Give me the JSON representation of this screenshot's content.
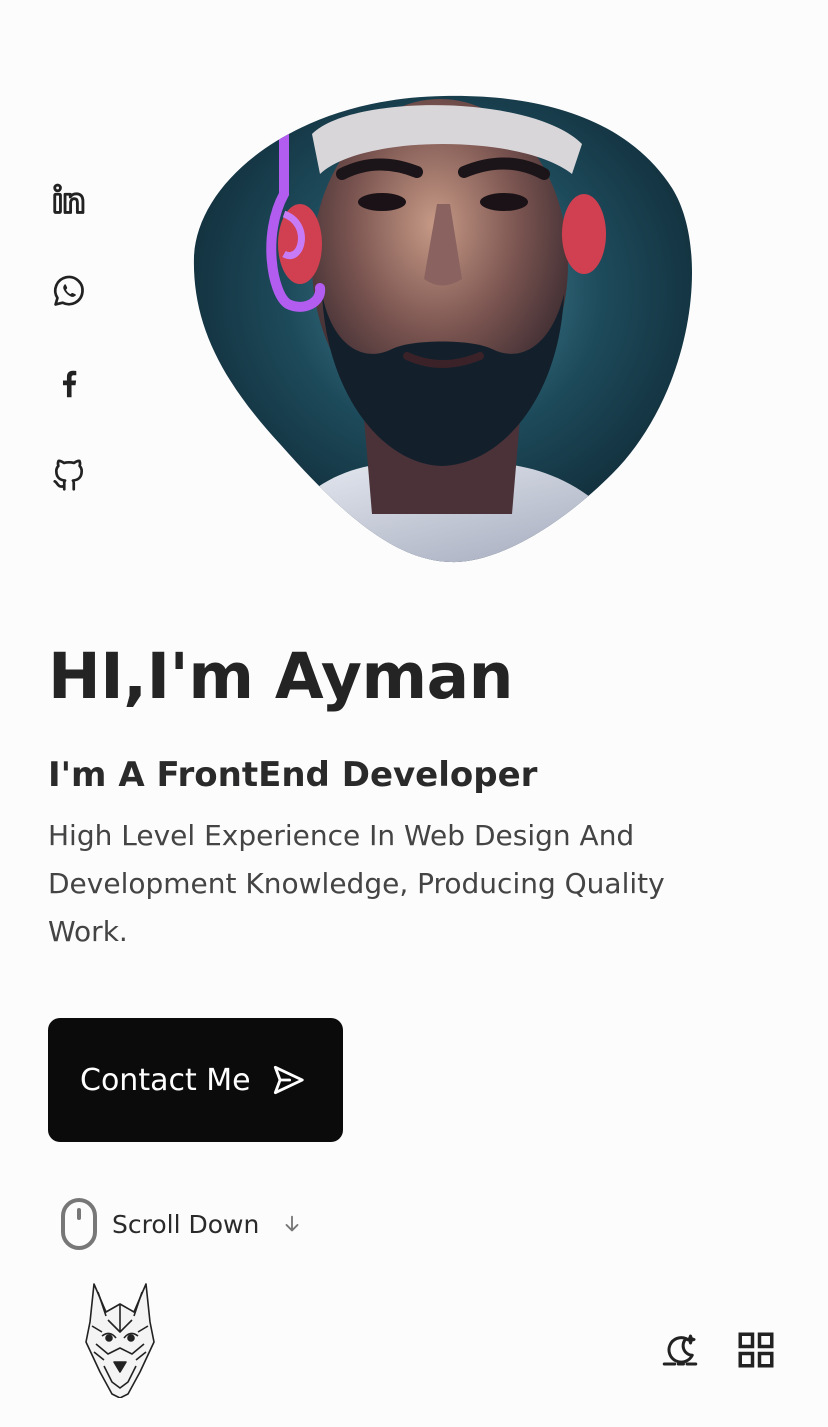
{
  "social": {
    "items": [
      {
        "name": "linkedin-icon"
      },
      {
        "name": "whatsapp-icon"
      },
      {
        "name": "facebook-icon"
      },
      {
        "name": "github-icon"
      }
    ]
  },
  "hero": {
    "title": "HI,I'm Ayman",
    "subtitle": "I'm A FrontEnd Developer",
    "description": "High Level Experience In Web Design And Development Knowledge, Producing Quality Work.",
    "contact_label": "Contact Me",
    "contact_icon": "send-icon"
  },
  "scroll": {
    "label": "Scroll Down",
    "mouse_icon": "mouse-icon",
    "arrow_icon": "arrow-down-icon"
  },
  "nav": {
    "logo": "wolf-logo",
    "theme_icon": "moon-icon",
    "menu_icon": "grid-menu-icon"
  },
  "colors": {
    "background": "#fcfcfd",
    "text": "#242424",
    "button": "#0b0b0b",
    "button_text": "#ffffff"
  }
}
